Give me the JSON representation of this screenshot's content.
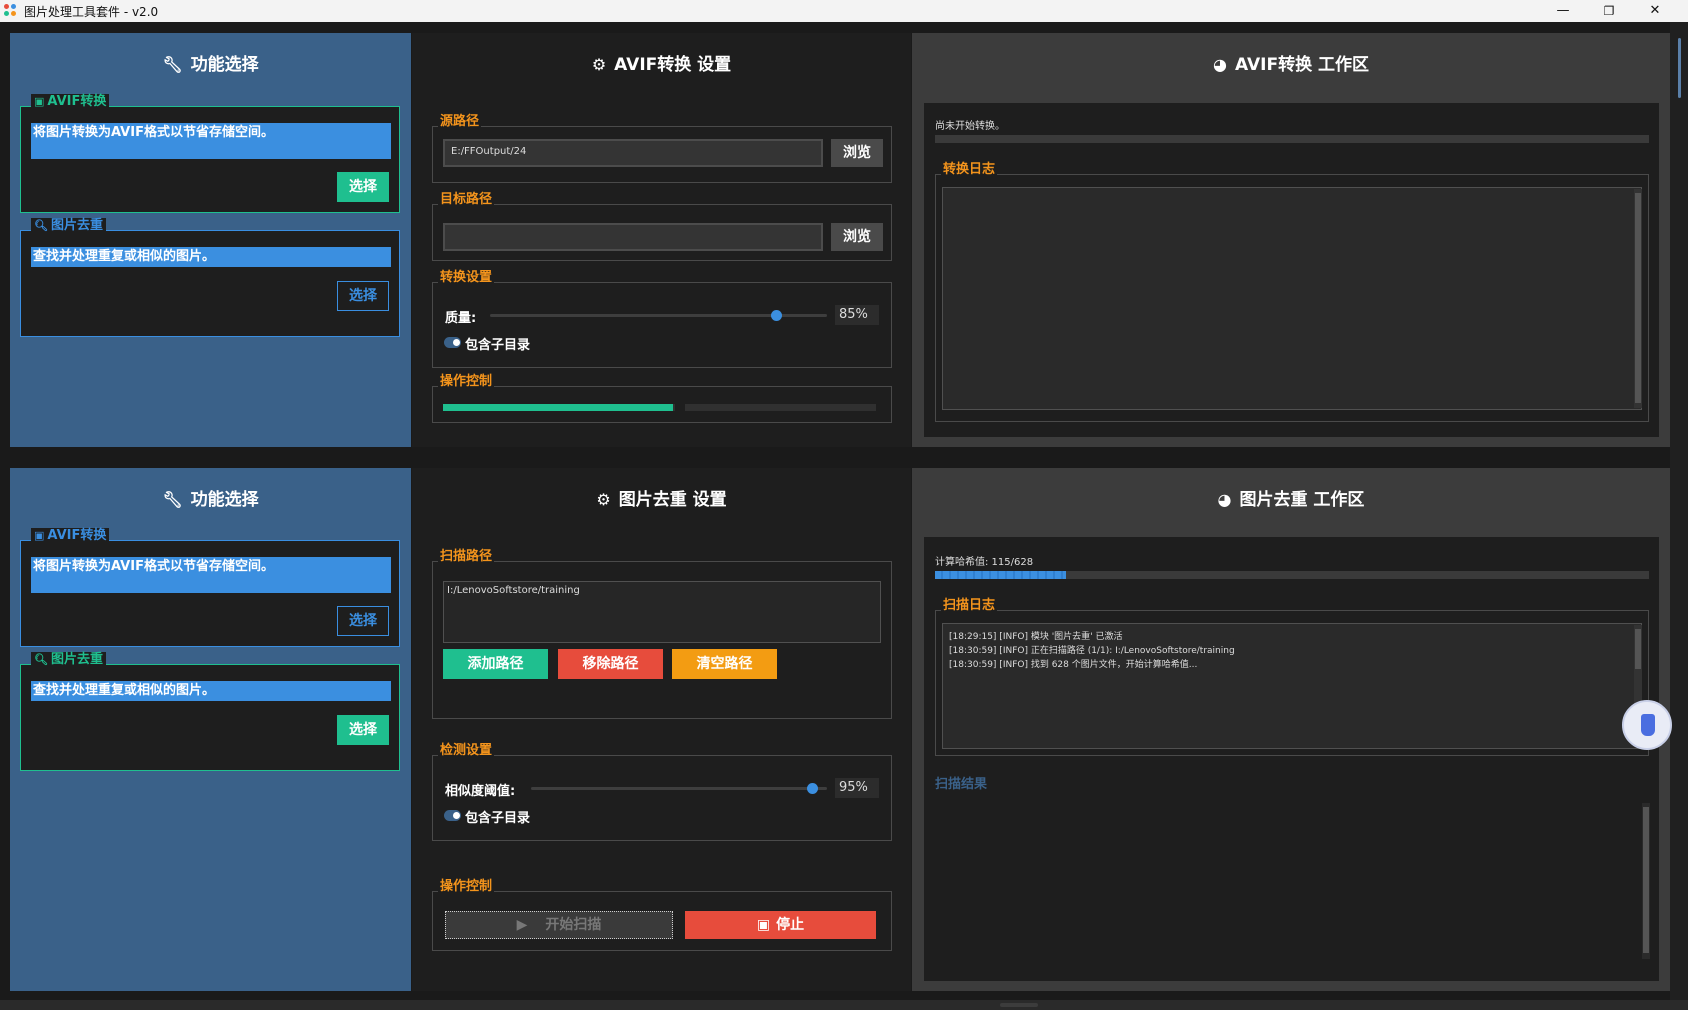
{
  "window": {
    "title": "图片处理工具套件 - v2.0",
    "minimize": "—",
    "maximize": "❐",
    "close": "✕"
  },
  "colors": {
    "sidebar_bg": "#3a6189",
    "teal": "#1fbf8f",
    "blue": "#3a8ee0",
    "orange": "#f4941c",
    "red": "#e74c3c",
    "panel_bg": "#1e1e1e",
    "workspace_bg": "#3c3c3c"
  },
  "top": {
    "sidebar": {
      "header": "功能选择",
      "header_icon": "wrench-icon",
      "cards": [
        {
          "icon": "image-icon",
          "title": "AVIF转换",
          "desc": "将图片转换为AVIF格式以节省存储空间。",
          "button": "选择"
        },
        {
          "icon": "search-icon",
          "title": "图片去重",
          "desc": "查找并处理重复或相似的图片。",
          "button": "选择"
        }
      ]
    },
    "settings": {
      "header": "AVIF转换 设置",
      "header_icon": "gear-icon",
      "source_path": {
        "title": "源路径",
        "value": "E:/FFOutput/24",
        "browse": "浏览"
      },
      "target_path": {
        "title": "目标路径",
        "value": "",
        "browse": "浏览"
      },
      "convert": {
        "title": "转换设置",
        "quality_label": "质量:",
        "quality_value": "85%",
        "quality": 0.85,
        "include_subdirs": "包含子目录"
      },
      "control": {
        "title": "操作控制",
        "progress": 0.52
      }
    },
    "workspace": {
      "header": "AVIF转换 工作区",
      "header_icon": "palette-icon",
      "status": "尚未开始转换。",
      "progress": 0,
      "log_title": "转换日志",
      "log_lines": []
    }
  },
  "bottom": {
    "sidebar": {
      "header": "功能选择",
      "header_icon": "wrench-icon",
      "cards": [
        {
          "icon": "image-icon",
          "title": "AVIF转换",
          "desc": "将图片转换为AVIF格式以节省存储空间。",
          "button": "选择"
        },
        {
          "icon": "search-icon",
          "title": "图片去重",
          "desc": "查找并处理重复或相似的图片。",
          "button": "选择"
        }
      ]
    },
    "settings": {
      "header": "图片去重 设置",
      "header_icon": "gear-icon",
      "scan": {
        "title": "扫描路径",
        "paths": [
          "I:/LenovoSoftstore/training"
        ],
        "add": "添加路径",
        "remove": "移除路径",
        "clear": "清空路径"
      },
      "detect": {
        "title": "检测设置",
        "similarity_label": "相似度阈值:",
        "similarity_value": "95%",
        "similarity": 0.95,
        "include_subdirs": "包含子目录"
      },
      "control": {
        "title": "操作控制",
        "start": "开始扫描",
        "stop": "停止"
      }
    },
    "workspace": {
      "header": "图片去重 工作区",
      "header_icon": "palette-icon",
      "status": "计算哈希值: 115/628",
      "progress": 0.183,
      "log_title": "扫描日志",
      "log_lines": [
        "[18:29:15] [INFO] 模块 '图片去重' 已激活",
        "[18:30:59] [INFO] 正在扫描路径 (1/1): I:/LenovoSoftstore/training",
        "[18:30:59] [INFO] 找到 628 个图片文件，开始计算哈希值..."
      ],
      "results_title": "扫描结果"
    }
  }
}
